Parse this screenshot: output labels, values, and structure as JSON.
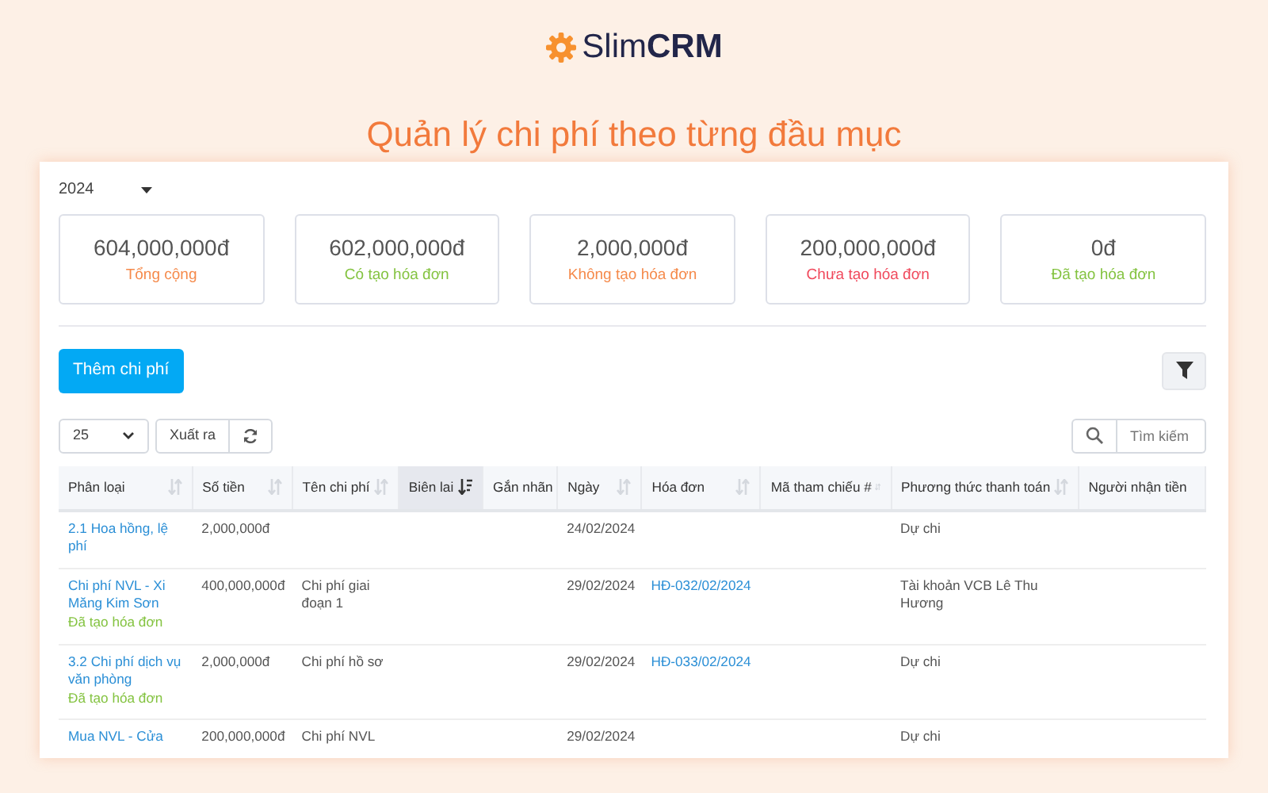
{
  "brand": {
    "name": "Slim**CRM**"
  },
  "headline": "Quản lý chi phí theo từng đầu mục",
  "year_select": {
    "value": "2024"
  },
  "stats": [
    {
      "value": "604,000,000đ",
      "label": "Tổng cộng",
      "color": "#f58a4b"
    },
    {
      "value": "602,000,000đ",
      "label": "Có tạo hóa đơn",
      "color": "#84c341"
    },
    {
      "value": "2,000,000đ",
      "label": "Không tạo hóa đơn",
      "color": "#f58a4b"
    },
    {
      "value": "200,000,000đ",
      "label": "Chưa tạo hóa đơn",
      "color": "#f0485b"
    },
    {
      "value": "0đ",
      "label": "Đã tạo hóa đơn",
      "color": "#84c341"
    }
  ],
  "add_button": "Thêm chi phí",
  "page_size": "25",
  "export_button": "Xuất ra",
  "search": {
    "placeholder": "Tìm kiếm"
  },
  "table": {
    "columns": [
      {
        "label": "Phân loại",
        "sorted": false
      },
      {
        "label": "Số tiền",
        "sorted": false
      },
      {
        "label": "Tên chi phí",
        "sorted": false
      },
      {
        "label": "Biên lai",
        "sorted": true
      },
      {
        "label": "Gắn nhãn",
        "sorted": false
      },
      {
        "label": "Ngày",
        "sorted": false
      },
      {
        "label": "Hóa đơn",
        "sorted": false
      },
      {
        "label": "Mã tham chiếu #",
        "sorted": false
      },
      {
        "label": "Phương thức thanh toán",
        "sorted": false
      },
      {
        "label": "Người nhận tiền",
        "sorted": false
      }
    ],
    "rows": [
      {
        "category": "2.1 Hoa hồng, lệ phí",
        "status": "",
        "amount": "2,000,000đ",
        "name": "",
        "date": "24/02/2024",
        "invoice": "",
        "payment": "Dự chi"
      },
      {
        "category": "Chi phí NVL - Xi Măng Kim Sơn",
        "status": "Đã tạo hóa đơn",
        "amount": "400,000,000đ",
        "name": "Chi phí giai đoạn 1",
        "date": "29/02/2024",
        "invoice": "HĐ-032/02/2024",
        "payment": "Tài khoản VCB Lê Thu Hương"
      },
      {
        "category": "3.2 Chi phí dịch vụ văn phòng",
        "status": "Đã tạo hóa đơn",
        "amount": "2,000,000đ",
        "name": "Chi phí hồ sơ",
        "date": "29/02/2024",
        "invoice": "HĐ-033/02/2024",
        "payment": "Dự chi"
      },
      {
        "category": "Mua NVL - Cửa",
        "status": "",
        "amount": "200,000,000đ",
        "name": "Chi phí NVL",
        "date": "29/02/2024",
        "invoice": "",
        "payment": "Dự chi"
      }
    ]
  }
}
